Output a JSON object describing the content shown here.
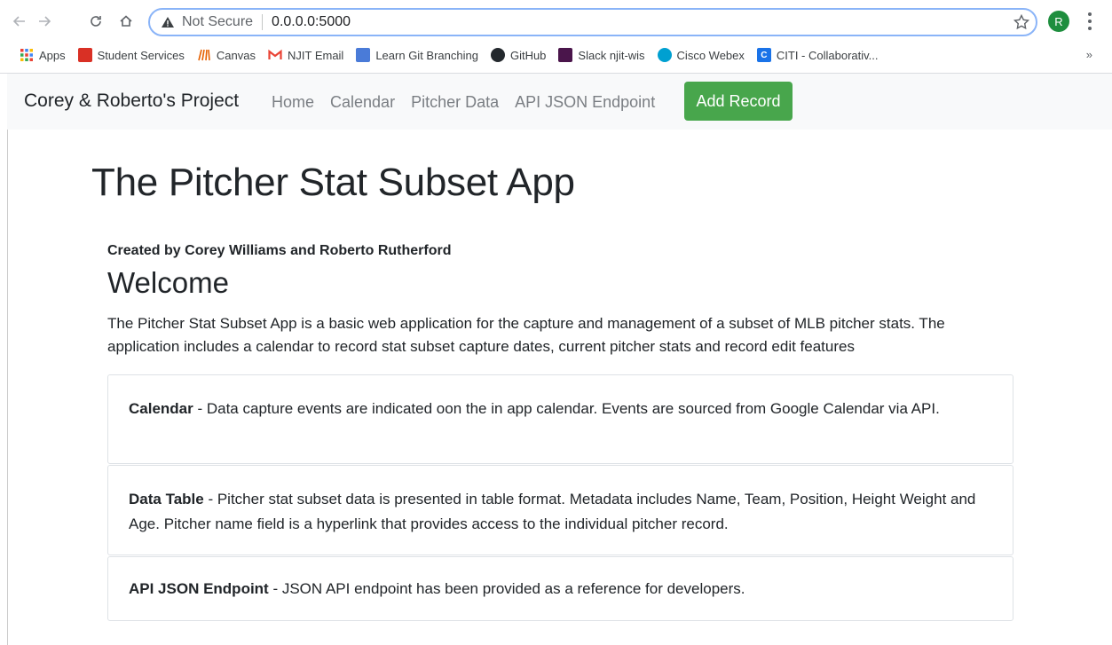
{
  "browser": {
    "security_label": "Not Secure",
    "url": "0.0.0.0:5000",
    "avatar_letter": "R",
    "bookmarks": [
      {
        "label": "Apps",
        "icon": "apps-grid-icon",
        "color": "#4285f4"
      },
      {
        "label": "Student Services",
        "icon": "student-services-icon",
        "color": "#d93025"
      },
      {
        "label": "Canvas",
        "icon": "canvas-icon",
        "color": "#e66000"
      },
      {
        "label": "NJIT Email",
        "icon": "gmail-icon",
        "color": "#ea4335"
      },
      {
        "label": "Learn Git Branching",
        "icon": "git-branching-icon",
        "color": "#4a7bd8"
      },
      {
        "label": "GitHub",
        "icon": "github-icon",
        "color": "#24292e"
      },
      {
        "label": "Slack njit-wis",
        "icon": "slack-icon",
        "color": "#4a154b"
      },
      {
        "label": "Cisco Webex",
        "icon": "webex-icon",
        "color": "#00a0d1"
      },
      {
        "label": "CITI - Collaborativ...",
        "icon": "citi-icon",
        "color": "#1a73e8"
      }
    ],
    "more_label": "»"
  },
  "navbar": {
    "brand": "Corey & Roberto's Project",
    "links": [
      "Home",
      "Calendar",
      "Pitcher Data",
      "API JSON Endpoint"
    ],
    "add_button": "Add Record",
    "add_color": "#48a64c"
  },
  "main": {
    "title": "The Pitcher Stat Subset App",
    "created_by": "Created by Corey Williams and Roberto Rutherford",
    "welcome": "Welcome",
    "intro": "The Pitcher Stat Subset App is a basic web application for the capture and management of a subset of MLB pitcher stats. The application includes a calendar to record stat subset capture dates, current pitcher stats and record edit features",
    "cards": [
      {
        "title": "Calendar",
        "text": " - Data capture events are indicated oon the in app calendar. Events are sourced from Google Calendar via API."
      },
      {
        "title": "Data Table",
        "text": " - Pitcher stat subset data is presented in table format. Metadata includes Name, Team, Position, Height Weight and Age. Pitcher name field is a hyperlink that provides access to the individual pitcher record."
      },
      {
        "title": "API JSON Endpoint",
        "text": " - JSON API endpoint has been provided as a reference for developers."
      }
    ]
  }
}
